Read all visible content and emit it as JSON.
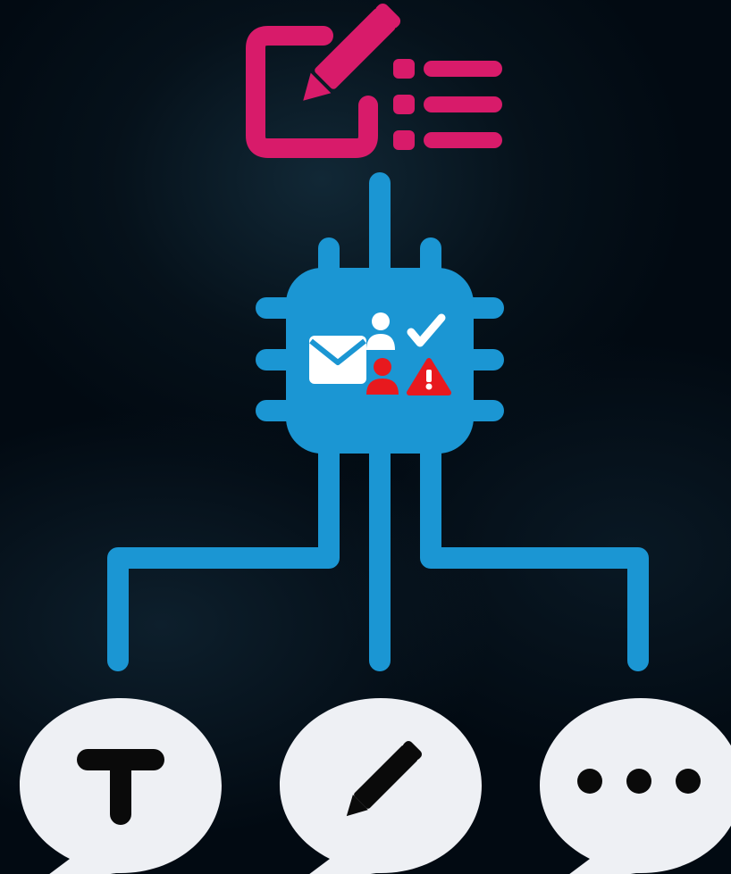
{
  "colors": {
    "background": "#020a12",
    "accent_magenta": "#d81b6a",
    "circuit_blue": "#1b96d3",
    "icon_white": "#ffffff",
    "alert_red": "#e8191e",
    "bubble_white": "#eef0f4",
    "glyph_black": "#0a0a0a"
  },
  "nodes": {
    "top": {
      "icon": "edit-list-icon"
    },
    "processor": {
      "icon": "chip-icon",
      "inner_icons": [
        "envelope-icon",
        "user-check-icon",
        "user-alert-icon"
      ]
    },
    "outputs": [
      {
        "icon": "text-bubble-icon",
        "glyph": "T"
      },
      {
        "icon": "pencil-bubble-icon"
      },
      {
        "icon": "ellipsis-bubble-icon"
      }
    ]
  }
}
